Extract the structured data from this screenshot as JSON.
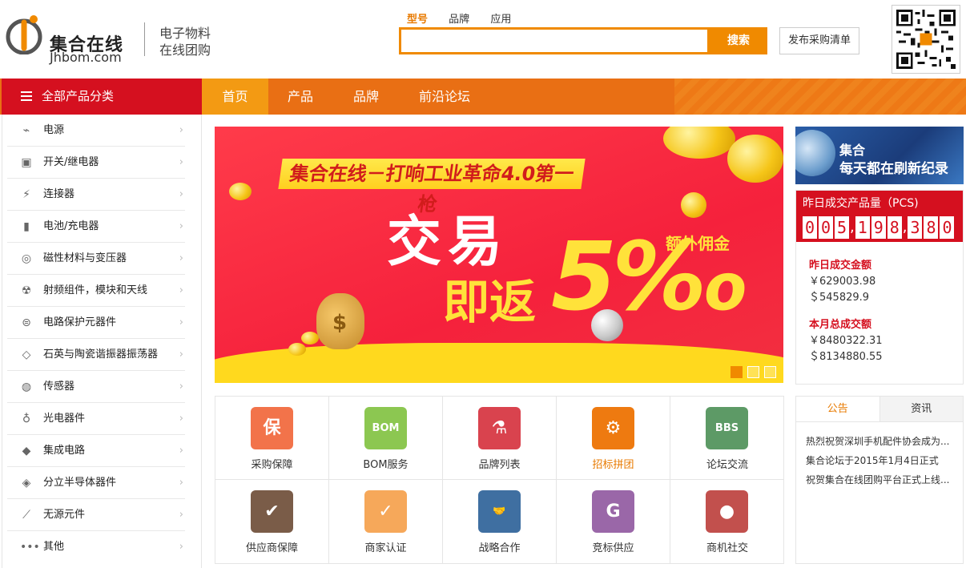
{
  "brand": {
    "name_cn": "集合在线",
    "domain": "Jhbom.com",
    "tagline1": "电子物料",
    "tagline2": "在线团购"
  },
  "search": {
    "tabs": [
      "型号",
      "品牌",
      "应用"
    ],
    "active_tab": "型号",
    "placeholder": "",
    "button_label": "搜索"
  },
  "publish_label": "发布采购清单",
  "nav": {
    "category_label": "全部产品分类",
    "items": [
      "首页",
      "产品",
      "品牌",
      "前沿论坛"
    ],
    "active": "首页"
  },
  "categories": [
    {
      "label": "电源",
      "icon": "power-icon"
    },
    {
      "label": "开关/继电器",
      "icon": "switch-icon"
    },
    {
      "label": "连接器",
      "icon": "connector-icon"
    },
    {
      "label": "电池/充电器",
      "icon": "battery-icon"
    },
    {
      "label": "磁性材料与变压器",
      "icon": "magnet-icon"
    },
    {
      "label": "射频组件，模块和天线",
      "icon": "radio-icon"
    },
    {
      "label": "电路保护元器件",
      "icon": "circuit-protect-icon"
    },
    {
      "label": "石英与陶瓷谐振器振荡器",
      "icon": "crystal-icon"
    },
    {
      "label": "传感器",
      "icon": "sensor-icon"
    },
    {
      "label": "光电器件",
      "icon": "bulb-icon"
    },
    {
      "label": "集成电路",
      "icon": "ic-icon"
    },
    {
      "label": "分立半导体器件",
      "icon": "semiconductor-icon"
    },
    {
      "label": "无源元件",
      "icon": "passive-icon"
    },
    {
      "label": "其他",
      "icon": "more-icon"
    }
  ],
  "banner": {
    "title": "集合在线－打响工业革命4.0第一枪",
    "big_text": "交易",
    "sub_text": "即返",
    "percent": "5‰",
    "extra": "额外佣金",
    "slides": 3,
    "active_slide": 1
  },
  "promo": {
    "line1": "集合",
    "line2": "每天都在刷新纪录"
  },
  "stats": {
    "title": "昨日成交产品量（PCS)",
    "count_groups": [
      "005",
      "198",
      "380"
    ],
    "yesterday_label": "昨日成交金额",
    "yesterday_cny": "￥629003.98",
    "yesterday_usd": "＄545829.9",
    "month_label": "本月总成交额",
    "month_cny": "￥8480322.31",
    "month_usd": "＄8134880.55"
  },
  "services": [
    {
      "label": "采购保障",
      "color": "#f2734a",
      "glyph": "保",
      "icon": "shield-icon",
      "highlight": false
    },
    {
      "label": "BOM服务",
      "color": "#8cc751",
      "glyph": "BOM",
      "icon": "bom-tag-icon",
      "highlight": false
    },
    {
      "label": "品牌列表",
      "color": "#d9434e",
      "glyph": "⚗",
      "icon": "flask-icon",
      "highlight": false
    },
    {
      "label": "招标拼团",
      "color": "#ee7a10",
      "glyph": "⚙",
      "icon": "gear-flow-icon",
      "highlight": true
    },
    {
      "label": "论坛交流",
      "color": "#5d9a66",
      "glyph": "BBS",
      "icon": "chat-icon",
      "highlight": false
    },
    {
      "label": "供应商保障",
      "color": "#7a5c48",
      "glyph": "✔",
      "icon": "badge-check-icon",
      "highlight": false
    },
    {
      "label": "商家认证",
      "color": "#f6a85a",
      "glyph": "✓",
      "icon": "user-verify-icon",
      "highlight": false
    },
    {
      "label": "战略合作",
      "color": "#3f6fa1",
      "glyph": "🤝",
      "icon": "handshake-icon",
      "highlight": false
    },
    {
      "label": "竞标供应",
      "color": "#9a67a8",
      "glyph": "G",
      "icon": "gnome-icon",
      "highlight": false
    },
    {
      "label": "商机社交",
      "color": "#c2504d",
      "glyph": "●",
      "icon": "social-icon",
      "highlight": false
    }
  ],
  "notice": {
    "tabs": [
      "公告",
      "资讯"
    ],
    "active_tab": "公告",
    "items": [
      "热烈祝贺深圳手机配件协会成为...",
      "集合论坛于2015年1月4日正式",
      "祝贺集合在线团购平台正式上线..."
    ]
  },
  "colors": {
    "accent": "#f08a00",
    "nav_bg": "#e96f14",
    "category_bg": "#d5101f",
    "stats_red": "#d5101f"
  }
}
